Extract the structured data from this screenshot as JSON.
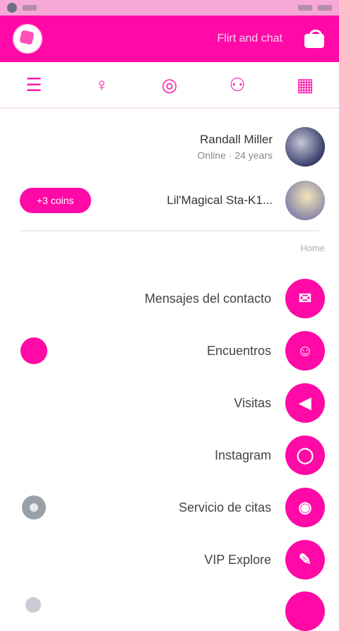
{
  "status_bar": {
    "left_text": "",
    "center_text": "",
    "right_text": ""
  },
  "app_bar": {
    "title": "Flirt and chat",
    "logo_icon": "app-logo",
    "right_icon": "store-icon"
  },
  "tabs": [
    {
      "name": "menu",
      "glyph": "☰"
    },
    {
      "name": "profile",
      "glyph": "♀"
    },
    {
      "name": "discover",
      "glyph": "◎"
    },
    {
      "name": "contacts",
      "glyph": "⚇"
    },
    {
      "name": "calendar",
      "glyph": "▦"
    }
  ],
  "profile": {
    "name": "Randall Miller",
    "subtitle": "Online · 24 years",
    "second_row_text": "Lil'Magical Sta-K1...",
    "second_row_button": "+3 coins"
  },
  "section_label": "Home",
  "menu_items": [
    {
      "label": "Mensajes del contacto",
      "icon_glyph": "✉",
      "left_badge": "none"
    },
    {
      "label": "Encuentros",
      "icon_glyph": "☺",
      "left_badge": "dot"
    },
    {
      "label": "Visitas",
      "icon_glyph": "◀",
      "left_badge": "none"
    },
    {
      "label": "Instagram",
      "icon_glyph": "◯",
      "left_badge": "none"
    },
    {
      "label": "Servicio de citas",
      "icon_glyph": "◉",
      "left_badge": "gear"
    },
    {
      "label": "VIP Explore",
      "icon_glyph": "✎",
      "left_badge": "none"
    }
  ],
  "colors": {
    "accent": "#ff0aa6",
    "status_bar": "#f7a8d6"
  }
}
